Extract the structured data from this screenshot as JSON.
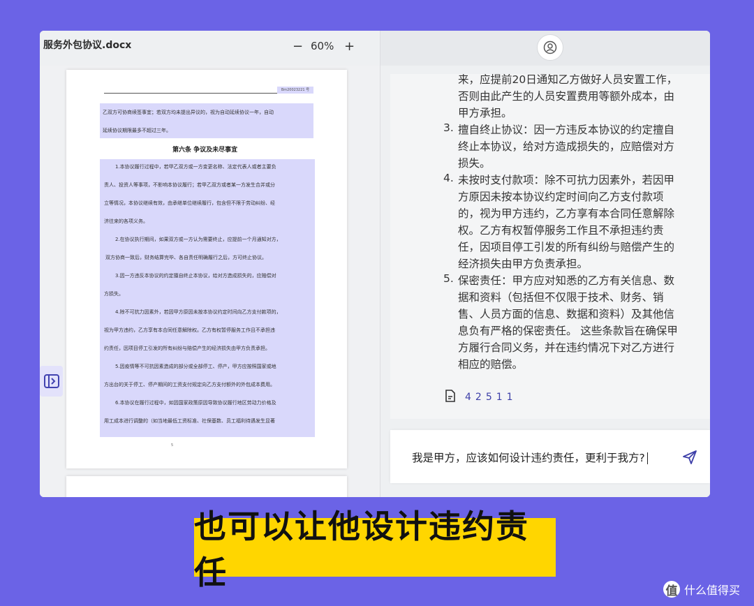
{
  "doc": {
    "filename": "服务外包协议.docx",
    "zoom": "60%",
    "zoom_out": "−",
    "zoom_in": "+",
    "code": "Bm20023221 号",
    "lines": [
      "乙双方可协商续签事宜；若双方均未提出异议的，视为自动延续协议一年，自动",
      "延续协议期限最多不超过三年。",
      "1.本协议履行过程中，若甲乙双方或一方变更名称、法定代表人或者主要负",
      "责人、投资人等事项，不影响本协议履行；若甲乙双方或者某一方发生合并或分",
      "立等情况，本协议继续有效，由承继单位继续履行，包含但不限于劳动纠纷、经",
      "济往来的各项义务。",
      "2.在协议执行期间，如果双方或一方认为需要终止，应提前一个月通知对方，",
      "双方协商一致后，财务结算完毕、各自责任明确履行之后，方可终止协议。",
      "3.因一方违反本协议的约定擅自终止本协议，给对方造成损失的，应赔偿对",
      "方损失。",
      "4.除不可抗力因素外，若因甲方原因未按本协议约定时间向乙方支付款项的，",
      "视为甲方违约，乙方享有本合同任意解除权。乙方有权暂停服务工作且不承担违",
      "约责任，因项目停工引发的所有纠纷与赔偿产生的经济损失由甲方负责承担。",
      "5.因疫情等不可抗因素造成的部分或全部停工、停产，甲方应按照国家或地",
      "方出台的关于停工、停产期间的工资支付规定向乙方支付额外的外包成本费用。",
      "6.本协议在履行过程中，如因国家政策原因导致协议履行地区劳动力价格及",
      "用工成本进行调整的（如当地最低工资标准、社保基数、员工福利待遇发生显著"
    ],
    "heading": "第六条 争议及未尽事宜",
    "page_number": "5"
  },
  "chat": {
    "answer_lines": [
      "来，应提前20日通知乙方做好人员安置工作，",
      "否则由此产生的人员安置费用等额外成本，由",
      "甲方承担。",
      "擅自终止协议：因一方违反本协议的约定擅自",
      "终止本协议，给对方造成损失的，应赔偿对方",
      "损失。",
      "未按时支付款项：除不可抗力因素外，若因甲",
      "方原因未按本协议约定时间向乙方支付款项",
      "的，视为甲方违约，乙方享有本合同任意解除",
      "权。乙方有权暂停服务工作且不承担违约责",
      "任，因项目停工引发的所有纠纷与赔偿产生的",
      "经济损失由甲方负责承担。",
      "保密责任：甲方应对知悉的乙方有关信息、数",
      "据和资料（包括但不仅限于技术、财务、销",
      "售、人员方面的信息、数据和资料）及其他信",
      "息负有严格的保密责任。 这些条款旨在确保甲",
      "方履行合同义务，并在违约情况下对乙方进行",
      "相应的赔偿。"
    ],
    "list_numbers": [
      "3.",
      "4.",
      "5."
    ],
    "citations": "42511",
    "input_value": "我是甲方，应该如何设计违约责任，更利于我方?"
  },
  "caption": "也可以让他设计违约责任",
  "watermark": {
    "logo": "值",
    "text": "什么值得买"
  },
  "colors": {
    "background": "#6b63e6",
    "highlight": "#d9d8fb",
    "caption_bg": "#ffd600",
    "accent": "#3d3fa8"
  }
}
